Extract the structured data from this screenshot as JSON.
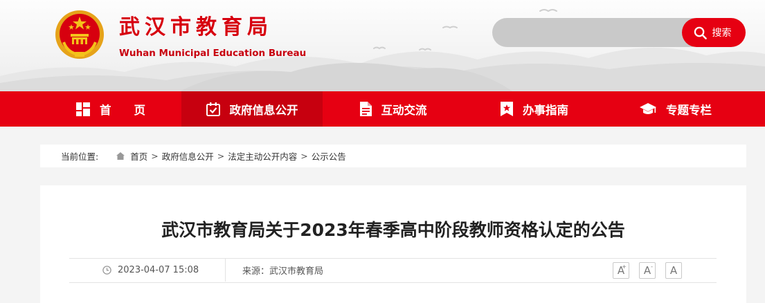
{
  "header": {
    "title": "武汉市教育局",
    "subtitle": "Wuhan Municipal Education Bureau",
    "search": {
      "placeholder": "",
      "button_label": "搜索"
    }
  },
  "nav": {
    "items": [
      {
        "label": "首　　页",
        "icon": "grid-icon",
        "active": false
      },
      {
        "label": "政府信息公开",
        "icon": "calendar-check-icon",
        "active": true
      },
      {
        "label": "互动交流",
        "icon": "document-icon",
        "active": false
      },
      {
        "label": "办事指南",
        "icon": "bookmark-star-icon",
        "active": false
      },
      {
        "label": "专题专栏",
        "icon": "graduation-cap-icon",
        "active": false
      }
    ]
  },
  "breadcrumb": {
    "label": "当前位置:",
    "items": [
      "首页",
      "政府信息公开",
      "法定主动公开内容",
      "公示公告"
    ],
    "separator": ">"
  },
  "article": {
    "title": "武汉市教育局关于2023年春季高中阶段教师资格认定的公告",
    "date": "2023-04-07 15:08",
    "source": "来源：武汉市教育局",
    "font_buttons": [
      "A",
      "A",
      "A"
    ],
    "font_button_marks": [
      "+",
      "-",
      ""
    ]
  },
  "colors": {
    "brand_red": "#e60012",
    "nav_active": "#c7000f",
    "title_red": "#d7000f"
  }
}
